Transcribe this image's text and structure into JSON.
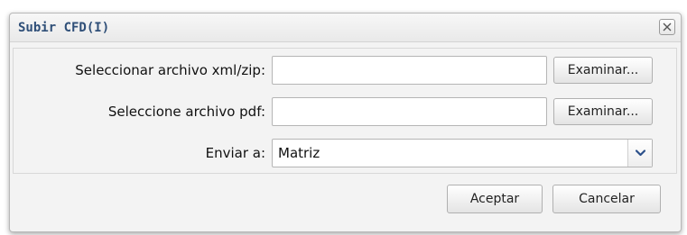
{
  "dialog": {
    "title": "Subir CFD(I)",
    "close_icon": "close-icon"
  },
  "form": {
    "xml_label": "Seleccionar archivo xml/zip:",
    "xml_value": "",
    "pdf_label": "Seleccione archivo pdf:",
    "pdf_value": "",
    "browse_label": "Examinar...",
    "send_to_label": "Enviar a:",
    "send_to_value": "Matriz",
    "dropdown_icon": "chevron-down-icon"
  },
  "footer": {
    "accept_label": "Aceptar",
    "cancel_label": "Cancelar"
  },
  "colors": {
    "title": "#2f4f78",
    "chevron": "#2a4f8a"
  }
}
